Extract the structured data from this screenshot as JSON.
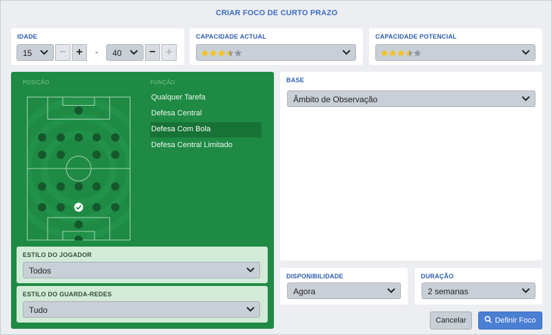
{
  "dialog": {
    "title": "CRIAR FOCO DE CURTO PRAZO"
  },
  "age": {
    "label": "IDADE",
    "min_value": "15",
    "separator": "-",
    "max_value": "40",
    "minus": "−",
    "plus": "+"
  },
  "current_ability": {
    "label": "CAPACIDADE ACTUAL",
    "stars": 3.5,
    "max_stars": 5
  },
  "potential_ability": {
    "label": "CAPACIDADE POTENCIAL",
    "stars": 3.5,
    "max_stars": 5
  },
  "position_panel": {
    "position_label": "POSIÇÃO",
    "role_label": "FUNÇÃO",
    "roles": [
      "Qualquer Tarefa",
      "Defesa Central",
      "Defesa Com Bola",
      "Defesa Central Limitado"
    ],
    "selected_role": "Defesa Com Bola",
    "selected_position": "defesa-central"
  },
  "player_style": {
    "label": "ESTILO DO JOGADOR",
    "value": "Todos"
  },
  "goalkeeper_style": {
    "label": "ESTILO DO GUARDA-REDES",
    "value": "Tudo"
  },
  "base": {
    "label": "BASE",
    "value": "Âmbito de Observação"
  },
  "availability": {
    "label": "DISPONIBILIDADE",
    "value": "Agora"
  },
  "duration": {
    "label": "DURAÇÃO",
    "value": "2 semanas"
  },
  "buttons": {
    "cancel": "Cancelar",
    "define": "Definir Foco"
  },
  "colors": {
    "accent": "#3b6cc4",
    "pitch": "#1e8a44",
    "star": "#f2c21b"
  }
}
